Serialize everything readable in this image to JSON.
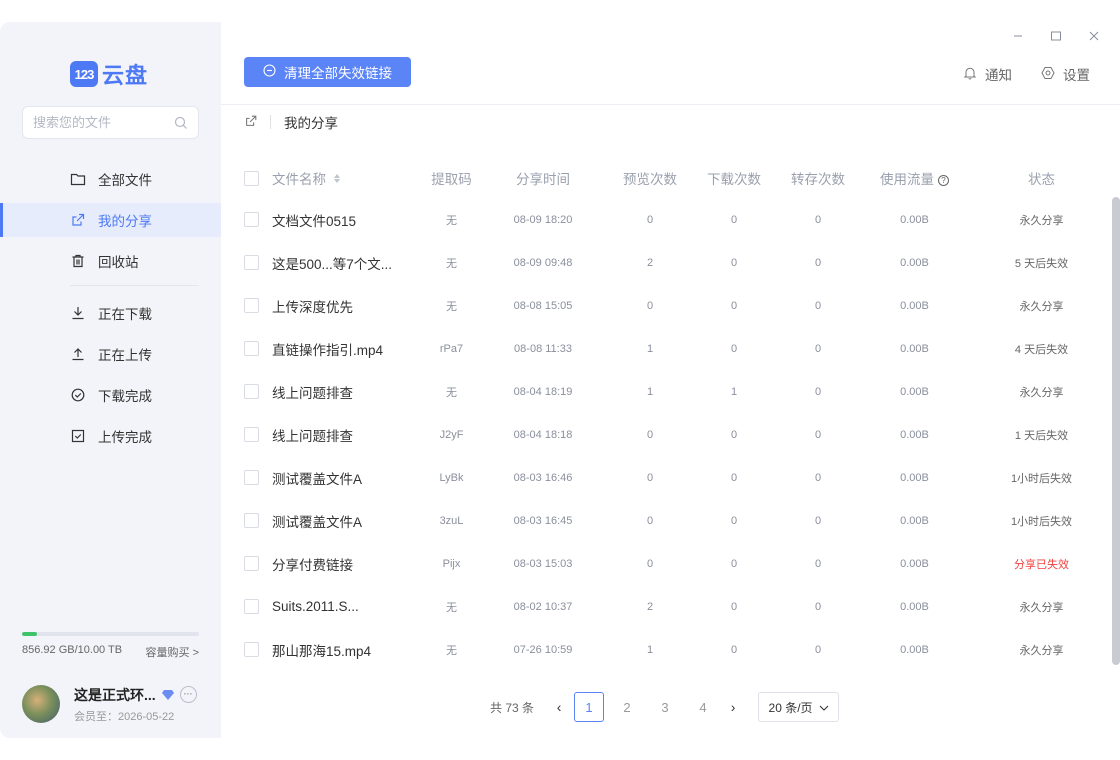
{
  "brand": {
    "logo_mark": "123",
    "logo_text": "云盘",
    "accent": "#4e79f5"
  },
  "search": {
    "placeholder": "搜索您的文件"
  },
  "nav": [
    {
      "label": "全部文件",
      "icon": "folder-icon"
    },
    {
      "label": "我的分享",
      "icon": "share-icon",
      "active": true
    },
    {
      "label": "回收站",
      "icon": "trash-icon"
    },
    {
      "label": "正在下载",
      "icon": "download-icon"
    },
    {
      "label": "正在上传",
      "icon": "upload-icon"
    },
    {
      "label": "下载完成",
      "icon": "check-circle-icon"
    },
    {
      "label": "上传完成",
      "icon": "check-square-icon"
    }
  ],
  "storage": {
    "used_text": "856.92 GB/10.00 TB",
    "buy_label": "容量购买 >",
    "used_fraction": 0.086
  },
  "user": {
    "name": "这是正式环...",
    "vip_text": "会员至：2026-05-22",
    "more": "···"
  },
  "toolbar": {
    "clean_label": "清理全部失效链接",
    "notify_label": "通知",
    "settings_label": "设置"
  },
  "breadcrumb": {
    "label": "我的分享"
  },
  "table": {
    "headers": {
      "name": "文件名称",
      "code": "提取码",
      "time": "分享时间",
      "preview": "预览次数",
      "download": "下载次数",
      "save": "转存次数",
      "flow": "使用流量",
      "status": "状态"
    },
    "rows": [
      {
        "name": "文档文件0515",
        "code": "无",
        "time": "08-09 18:20",
        "preview": "0",
        "download": "0",
        "save": "0",
        "flow": "0.00B",
        "status": "永久分享",
        "expired": false
      },
      {
        "name": "这是500...等7个文...",
        "code": "无",
        "time": "08-09 09:48",
        "preview": "2",
        "download": "0",
        "save": "0",
        "flow": "0.00B",
        "status": "5 天后失效",
        "expired": false
      },
      {
        "name": "上传深度优先",
        "code": "无",
        "time": "08-08 15:05",
        "preview": "0",
        "download": "0",
        "save": "0",
        "flow": "0.00B",
        "status": "永久分享",
        "expired": false
      },
      {
        "name": "直链操作指引.mp4",
        "code": "rPa7",
        "time": "08-08 11:33",
        "preview": "1",
        "download": "0",
        "save": "0",
        "flow": "0.00B",
        "status": "4 天后失效",
        "expired": false
      },
      {
        "name": "线上问题排查",
        "code": "无",
        "time": "08-04 18:19",
        "preview": "1",
        "download": "1",
        "save": "0",
        "flow": "0.00B",
        "status": "永久分享",
        "expired": false
      },
      {
        "name": "线上问题排查",
        "code": "J2yF",
        "time": "08-04 18:18",
        "preview": "0",
        "download": "0",
        "save": "0",
        "flow": "0.00B",
        "status": "1 天后失效",
        "expired": false
      },
      {
        "name": "测试覆盖文件A",
        "code": "LyBk",
        "time": "08-03 16:46",
        "preview": "0",
        "download": "0",
        "save": "0",
        "flow": "0.00B",
        "status": "1小时后失效",
        "expired": false
      },
      {
        "name": "测试覆盖文件A",
        "code": "3zuL",
        "time": "08-03 16:45",
        "preview": "0",
        "download": "0",
        "save": "0",
        "flow": "0.00B",
        "status": "1小时后失效",
        "expired": false
      },
      {
        "name": "分享付费链接",
        "code": "Pijx",
        "time": "08-03 15:03",
        "preview": "0",
        "download": "0",
        "save": "0",
        "flow": "0.00B",
        "status": "分享已失效",
        "expired": true
      },
      {
        "name": "Suits.2011.S...",
        "code": "无",
        "time": "08-02 10:37",
        "preview": "2",
        "download": "0",
        "save": "0",
        "flow": "0.00B",
        "status": "永久分享",
        "expired": false
      },
      {
        "name": "那山那海15.mp4",
        "code": "无",
        "time": "07-26 10:59",
        "preview": "1",
        "download": "0",
        "save": "0",
        "flow": "0.00B",
        "status": "永久分享",
        "expired": false
      }
    ]
  },
  "pager": {
    "total": "共 73 条",
    "pages": [
      "1",
      "2",
      "3",
      "4"
    ],
    "current": "1",
    "size_label": "20 条/页"
  }
}
